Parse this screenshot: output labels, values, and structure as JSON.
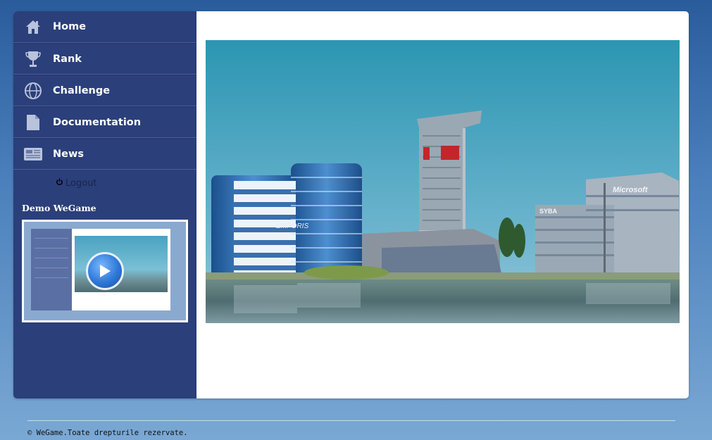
{
  "sidebar": {
    "items": [
      {
        "label": "Home",
        "icon": "home-icon"
      },
      {
        "label": "Rank",
        "icon": "trophy-icon"
      },
      {
        "label": "Challenge",
        "icon": "globe-icon"
      },
      {
        "label": "Documentation",
        "icon": "document-icon"
      },
      {
        "label": "News",
        "icon": "newspaper-icon"
      }
    ],
    "logout_label": "Logout",
    "demo_title": "Demo WeGame"
  },
  "banner": {
    "building_logo_1": "EMPORIS",
    "building_logo_2": "Microsoft",
    "building_logo_3": "SYBA"
  },
  "footer": {
    "copyright": "© WeGame.Toate drepturile rezervate."
  },
  "colors": {
    "sidebar_bg": "#2b3f7a",
    "page_gradient_top": "#2a5c9c",
    "page_gradient_bottom": "#7aa8d4"
  }
}
